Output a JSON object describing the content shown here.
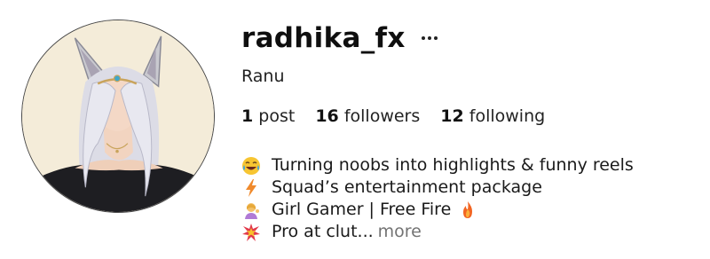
{
  "profile": {
    "username": "radhika_fx",
    "display_name": "Ranu",
    "stats": {
      "posts_count": "1",
      "posts_label": "post",
      "followers_count": "16",
      "followers_label": "followers",
      "following_count": "12",
      "following_label": "following"
    },
    "bio": [
      {
        "icon": "tears-of-joy-emoji-icon",
        "text": "Turning noobs into highlights & funny reels"
      },
      {
        "icon": "lightning-emoji-icon",
        "text": "Squad’s entertainment package"
      },
      {
        "icon": "woman-tipping-hand-emoji-icon",
        "text": "Girl Gamer | Free Fire",
        "trailing_icon": "fire-emoji-icon"
      },
      {
        "icon": "collision-emoji-icon",
        "text": "Pro at clut...",
        "more": "more"
      }
    ]
  }
}
